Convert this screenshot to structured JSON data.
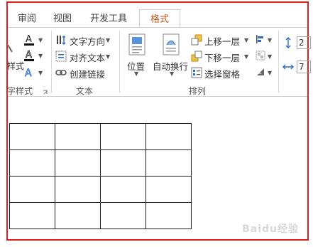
{
  "tabs": [
    {
      "label": "审阅"
    },
    {
      "label": "视图"
    },
    {
      "label": "开发工具"
    },
    {
      "label": "格式",
      "active": true
    }
  ],
  "ribbon": {
    "style_group": {
      "partial_label": "样式",
      "group_label": "字样式"
    },
    "text_group": {
      "text_direction": "文字方向",
      "align_text": "对齐文本",
      "create_link": "创建链接",
      "group_label": "文本"
    },
    "arrange_group": {
      "position": "位置",
      "wrap_text": "自动换行",
      "bring_forward": "上移一层",
      "send_backward": "下移一层",
      "selection_pane": "选择窗格",
      "group_label": "排列"
    },
    "size_group": {
      "height_value": "2",
      "width_value": "7"
    }
  },
  "document": {
    "table_rows": 4,
    "table_cols": 4
  },
  "watermark": "Baidu经验",
  "colors": {
    "accent": "#c25a1e",
    "frame": "#d9211d"
  }
}
